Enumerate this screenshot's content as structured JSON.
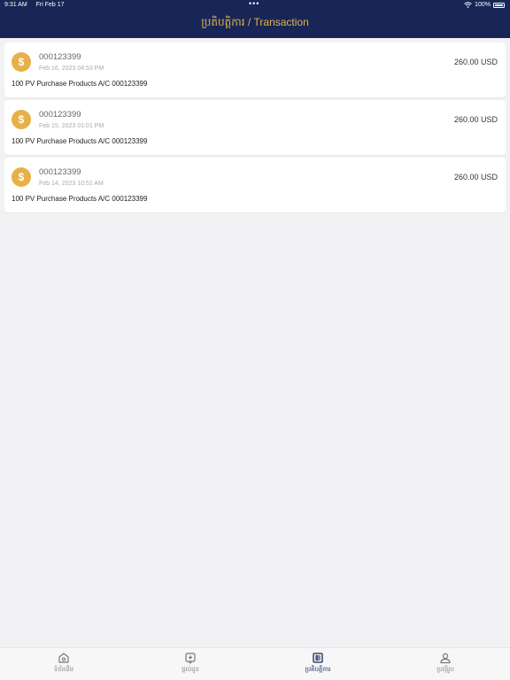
{
  "status": {
    "time": "9:31 AM",
    "date": "Fri Feb 17",
    "battery": "100%"
  },
  "header": {
    "title_khmer": "ប្រតិបត្តិការ",
    "title_sep": " / ",
    "title_en": "Transaction"
  },
  "transactions": [
    {
      "account": "000123399",
      "date": "Feb 16, 2023 04:53 PM",
      "amount": "260.00 USD",
      "description": "100 PV Purchase  Products A/C 000123399"
    },
    {
      "account": "000123399",
      "date": "Feb 15, 2023 01:01 PM",
      "amount": "260.00 USD",
      "description": "100 PV Purchase  Products A/C 000123399"
    },
    {
      "account": "000123399",
      "date": "Feb 14, 2023 10:51 AM",
      "amount": "260.00 USD",
      "description": "100 PV Purchase  Products A/C 000123399"
    }
  ],
  "coin_symbol": "$",
  "tabs": [
    {
      "label": "ទំព័រដើម",
      "icon": "home-icon"
    },
    {
      "label": "ផ្តល់ជូន",
      "icon": "offer-icon"
    },
    {
      "label": "ប្រតិបត្តិការ",
      "icon": "transaction-icon",
      "active": true
    },
    {
      "label": "ប្រវត្តិរូប",
      "icon": "profile-icon"
    }
  ],
  "colors": {
    "header_bg": "#172656",
    "accent_gold": "#e4b44a",
    "coin": "#e7b14a"
  }
}
